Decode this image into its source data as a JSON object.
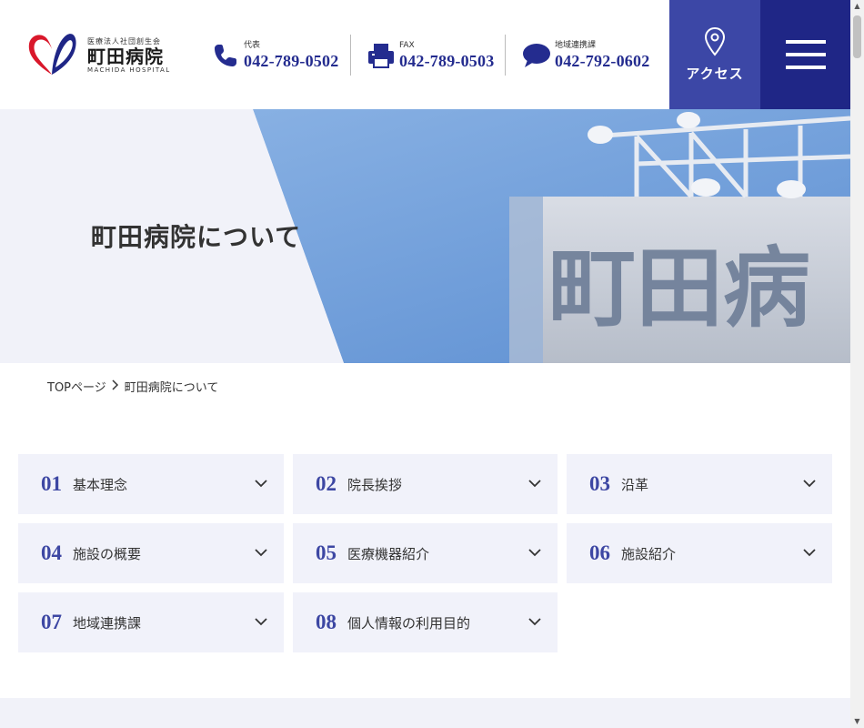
{
  "header": {
    "logo": {
      "subtitle": "医療法人社団創生会",
      "name": "町田病院",
      "name_en": "MACHIDA HOSPITAL"
    },
    "contacts": [
      {
        "label": "代表",
        "number": "042-789-0502",
        "icon": "phone-icon"
      },
      {
        "label": "FAX",
        "number": "042-789-0503",
        "icon": "fax-icon"
      },
      {
        "label": "地域連携課",
        "number": "042-792-0602",
        "icon": "chat-icon"
      }
    ],
    "access_label": "アクセス",
    "menu_icon": "hamburger-menu-icon"
  },
  "hero": {
    "title": "町田病院について",
    "building_sign": "町田病"
  },
  "breadcrumb": {
    "home": "TOPページ",
    "current": "町田病院について"
  },
  "nav": [
    {
      "num": "01",
      "label": "基本理念"
    },
    {
      "num": "02",
      "label": "院長挨拶"
    },
    {
      "num": "03",
      "label": "沿革"
    },
    {
      "num": "04",
      "label": "施設の概要"
    },
    {
      "num": "05",
      "label": "医療機器紹介"
    },
    {
      "num": "06",
      "label": "施設紹介"
    },
    {
      "num": "07",
      "label": "地域連携課"
    },
    {
      "num": "08",
      "label": "個人情報の利用目的"
    }
  ],
  "colors": {
    "brand_navy": "#1f2686",
    "brand_blue": "#3c47a6",
    "accent_red": "#d9182b",
    "card_bg": "#f1f2fa",
    "number_blue": "#242c8f"
  }
}
